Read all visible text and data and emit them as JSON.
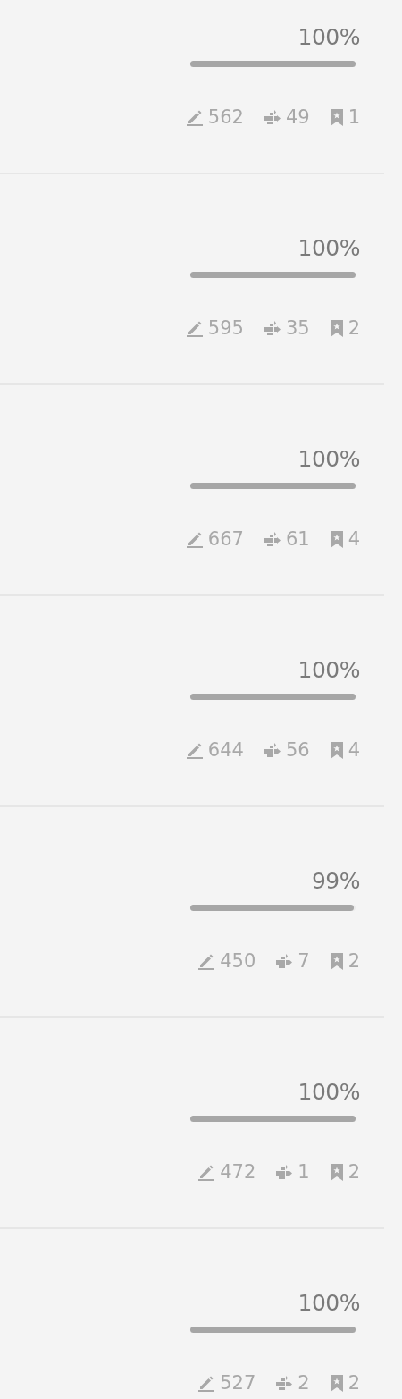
{
  "items": [
    {
      "percent": "100%",
      "level": 1,
      "edits": "562",
      "changes": "49",
      "bookmarks": "1"
    },
    {
      "percent": "100%",
      "level": 1,
      "edits": "595",
      "changes": "35",
      "bookmarks": "2"
    },
    {
      "percent": "100%",
      "level": 1,
      "edits": "667",
      "changes": "61",
      "bookmarks": "4"
    },
    {
      "percent": "100%",
      "level": 1,
      "edits": "644",
      "changes": "56",
      "bookmarks": "4"
    },
    {
      "percent": "99%",
      "level": 0.99,
      "edits": "450",
      "changes": "7",
      "bookmarks": "2"
    },
    {
      "percent": "100%",
      "level": 1,
      "edits": "472",
      "changes": "1",
      "bookmarks": "2"
    },
    {
      "percent": "100%",
      "level": 1,
      "edits": "527",
      "changes": "2",
      "bookmarks": "2"
    }
  ]
}
